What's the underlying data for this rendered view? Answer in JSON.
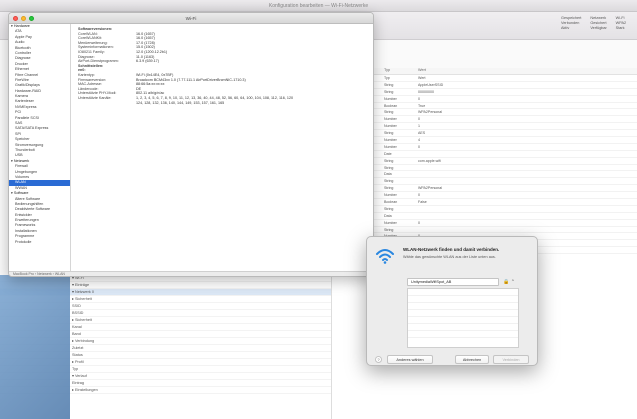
{
  "bg": {
    "window_title": "Konfiguration bearbeiten — Wi-Fi-Netzwerke",
    "toolbar_info": [
      "Gespeichert",
      "Netzwerk",
      "Wi-Fi",
      "Verbunden",
      "Gesichert",
      "WPA2",
      "Aktiv",
      "Verfügbar",
      "Stark"
    ],
    "table_header": [
      "Schlüssel",
      "Typ",
      "Wert"
    ],
    "table_rows": [
      [
        "Eintrag",
        "Typ",
        "Wert"
      ],
      [
        "",
        "String",
        "AppleUserSSID"
      ],
      [
        "",
        "String",
        "00000000"
      ],
      [
        "",
        "Number",
        "0"
      ],
      [
        "",
        "Boolean",
        "True"
      ],
      [
        "",
        "String",
        "WPA2Personal"
      ],
      [
        "",
        "Number",
        "0"
      ],
      [
        "",
        "Number",
        "1"
      ],
      [
        "",
        "String",
        "AES"
      ],
      [
        "",
        "Number",
        "4"
      ],
      [
        "",
        "Number",
        "0"
      ],
      [
        "",
        "Date",
        ""
      ],
      [
        "",
        "String",
        "com.apple.wifi"
      ],
      [
        "",
        "String",
        ""
      ],
      [
        "",
        "Data",
        ""
      ],
      [
        "",
        "String",
        ""
      ],
      [
        "",
        "String",
        "WPA2Personal"
      ],
      [
        "",
        "Number",
        "0"
      ],
      [
        "",
        "Boolean",
        "False"
      ],
      [
        "",
        "String",
        ""
      ],
      [
        "",
        "Data",
        ""
      ],
      [
        "",
        "Number",
        "0"
      ],
      [
        "",
        "String",
        ""
      ],
      [
        "",
        "Number",
        "0"
      ],
      [
        "",
        "String",
        ""
      ],
      [
        "",
        "Number",
        "0"
      ]
    ],
    "tree_rows": [
      "▾ Wi-Fi",
      "  ▾ Einträge",
      "    ▾ Netzwerk 0",
      "      ▸ Sicherheit",
      "        SSID",
      "        BSSID",
      "      ▸ Sicherheit",
      "        Kanal",
      "        Band",
      "      ▸ Verbindung",
      "        Zuletzt",
      "        Status",
      "      ▸ Profil",
      "        Typ",
      "      ▾ Verlauf",
      "        Eintrag",
      "  ▸ Einstellungen"
    ]
  },
  "sys": {
    "title": "Wi-Fi",
    "sidebar": [
      {
        "label": "▾ Hardware",
        "group": true
      },
      {
        "label": "ATA"
      },
      {
        "label": "Apple Pay"
      },
      {
        "label": "Audio"
      },
      {
        "label": "Bluetooth"
      },
      {
        "label": "Controller"
      },
      {
        "label": "Diagnose"
      },
      {
        "label": "Drucker"
      },
      {
        "label": "Ethernet"
      },
      {
        "label": "Fibre Channel"
      },
      {
        "label": "FireWire"
      },
      {
        "label": "Grafik/Displays"
      },
      {
        "label": "Hardware-RAID"
      },
      {
        "label": "Kamera"
      },
      {
        "label": "Kartenleser"
      },
      {
        "label": "NVMExpress"
      },
      {
        "label": "PCI"
      },
      {
        "label": "Parallele SCSI"
      },
      {
        "label": "SAS"
      },
      {
        "label": "SATA/SATA Express"
      },
      {
        "label": "SPI"
      },
      {
        "label": "Speicher"
      },
      {
        "label": "Stromversorgung"
      },
      {
        "label": "Thunderbolt"
      },
      {
        "label": "USB"
      },
      {
        "label": "▾ Netzwerk",
        "group": true
      },
      {
        "label": "Firewall"
      },
      {
        "label": "Umgebungen"
      },
      {
        "label": "Volumes"
      },
      {
        "label": "WLAN",
        "sel": true
      },
      {
        "label": "WWAN"
      },
      {
        "label": "▾ Software",
        "group": true
      },
      {
        "label": "Ältere Software"
      },
      {
        "label": "Bedienungshilfen"
      },
      {
        "label": "Deaktivierte Software"
      },
      {
        "label": "Entwickler"
      },
      {
        "label": "Erweiterungen"
      },
      {
        "label": "Frameworks"
      },
      {
        "label": "Installationen"
      },
      {
        "label": "Programme"
      },
      {
        "label": "Protokolle"
      }
    ],
    "detail": [
      {
        "k": "Softwareversionen:",
        "v": "",
        "h": true
      },
      {
        "k": "CoreWLAN:",
        "v": "16.0 (1657)"
      },
      {
        "k": "CoreWLANKit:",
        "v": "16.0 (1657)"
      },
      {
        "k": "Menüerweiterung:",
        "v": "17.0 (1728)"
      },
      {
        "k": "Systeminformationen:",
        "v": "15.0 (1502)"
      },
      {
        "k": "IO80211 Family:",
        "v": "12.0 (1200.12.2b1)"
      },
      {
        "k": "Diagnose:",
        "v": "11.0 (1163)"
      },
      {
        "k": "AirPort-Dienstprogramm:",
        "v": "6.3.9 (639.17)"
      },
      {
        "k": "Schnittstellen:",
        "v": "",
        "h": true
      },
      {
        "k": "en0:",
        "v": "",
        "h": true
      },
      {
        "k": "Kartentyp:",
        "v": "Wi-Fi (0x14E4, 0x7BF)"
      },
      {
        "k": "Firmwareversion:",
        "v": "Broadcom BCM43xx 1.0 (7.77.111.1 AirPortDriverBrcmNIC-1710.3)"
      },
      {
        "k": "MAC-Adresse:",
        "v": "88:66:5a:xx:xx:xx"
      },
      {
        "k": "Ländercode:",
        "v": "DE"
      },
      {
        "k": "Unterstützte PHY-Modi:",
        "v": "802.11 a/b/g/n/ac"
      },
      {
        "k": "Unterstützte Kanäle:",
        "v": "1, 2, 3, 4, 5, 6, 7, 8, 9, 10, 11, 12, 13, 36, 40, 44, 48, 52, 56, 60, 64, 100, 104, 108, 112, 116, 120"
      },
      {
        "k": "",
        "v": "124, 128, 132, 136, 140, 144, 149, 153, 157, 161, 165"
      }
    ],
    "status": "MacBook Pro › Netzwerk › WLAN"
  },
  "wifi": {
    "title": "WLAN-Netzwerk finden und damit verbinden.",
    "subtitle": "Wähle das gewünschte WLAN aus der Liste unten aus.",
    "selected_network": "UnitymediaWifiSpot_AB",
    "buttons": {
      "other": "Anderes wählen",
      "cancel": "Abbrechen",
      "join": "Verbinden"
    },
    "help": "?"
  }
}
